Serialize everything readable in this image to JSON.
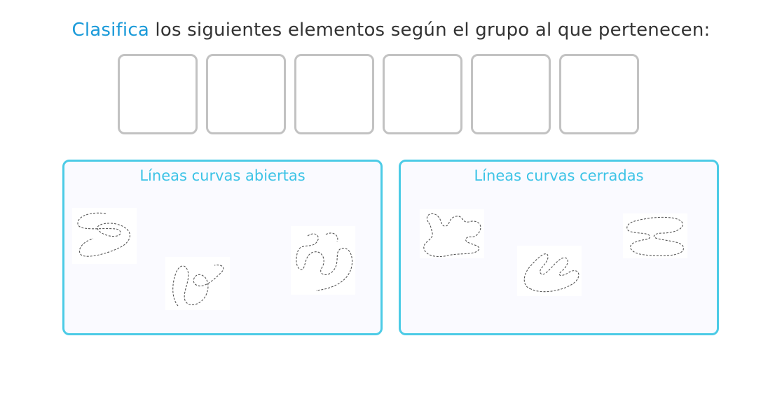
{
  "instruction": {
    "verb": "Clasifica",
    "rest": " los siguientes elementos según el grupo al que pertenecen:"
  },
  "zones": {
    "open": {
      "title": "Líneas curvas abiertas"
    },
    "closed": {
      "title": "Líneas curvas cerradas"
    }
  },
  "colors": {
    "accent_verb": "#1a9ad9",
    "zone_border": "#4ccbe6",
    "zone_title": "#3cc3e6",
    "slot_border": "#c2c2c2"
  }
}
